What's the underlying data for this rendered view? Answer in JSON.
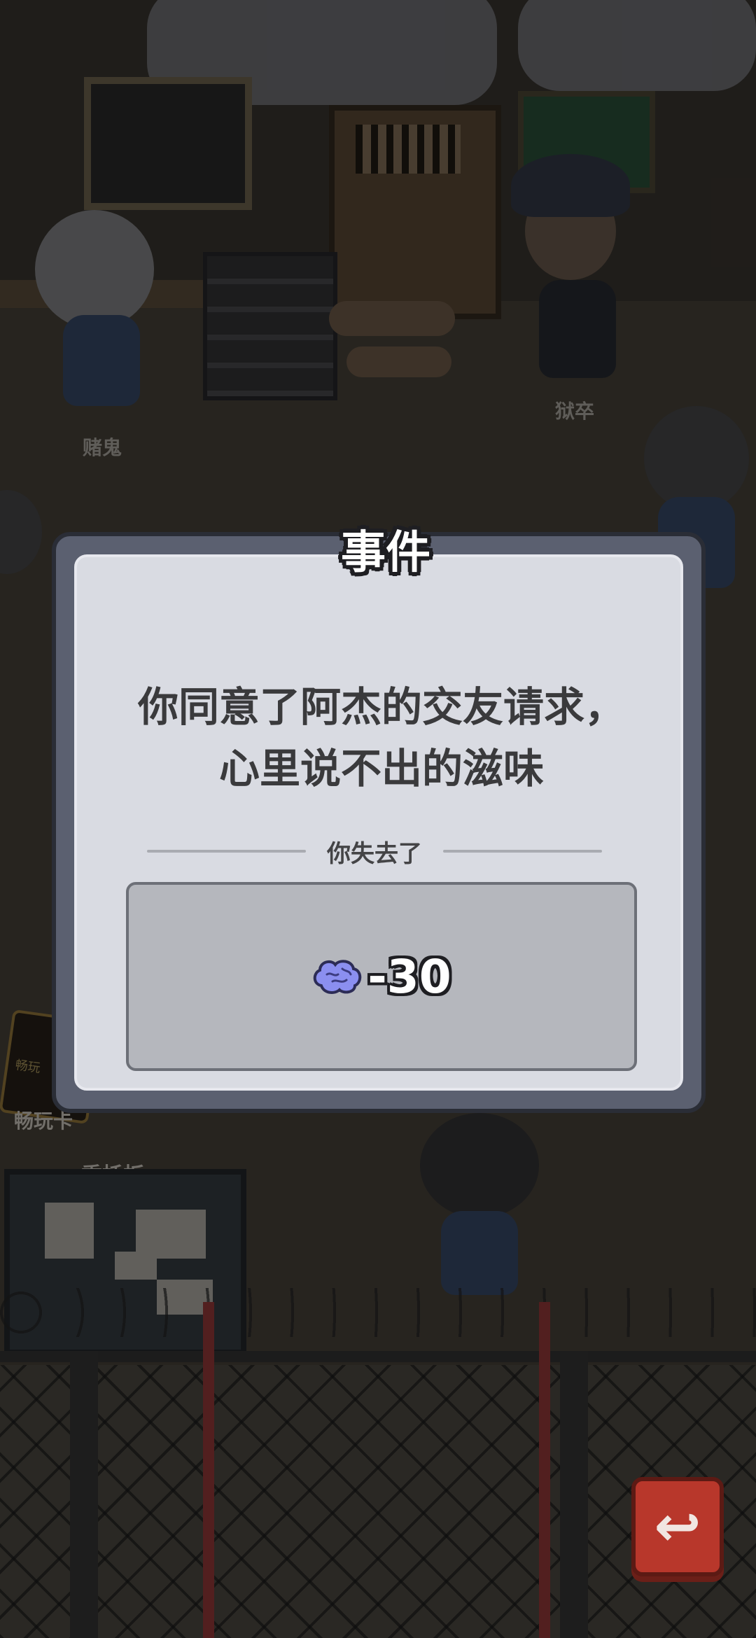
{
  "scene": {
    "npc_labels": {
      "gambler": "赌鬼",
      "guard": "狱卒"
    },
    "play_card_label": "畅玩卡",
    "play_card_text": "畅玩",
    "board_label": "委托板"
  },
  "dialog": {
    "title": "事件",
    "event_line1": "你同意了阿杰的交友请求，",
    "event_line2": "心里说不出的滋味",
    "result_label": "你失去了",
    "reward": {
      "icon": "brain-icon",
      "value": "-30"
    }
  },
  "controls": {
    "back_icon": "↩"
  },
  "colors": {
    "dialog_frame": "#5b6070",
    "dialog_panel": "#d9dbe2",
    "reward_panel": "#b5b7bd",
    "brain": "#8b8ff0",
    "back_button": "#b8372b"
  }
}
